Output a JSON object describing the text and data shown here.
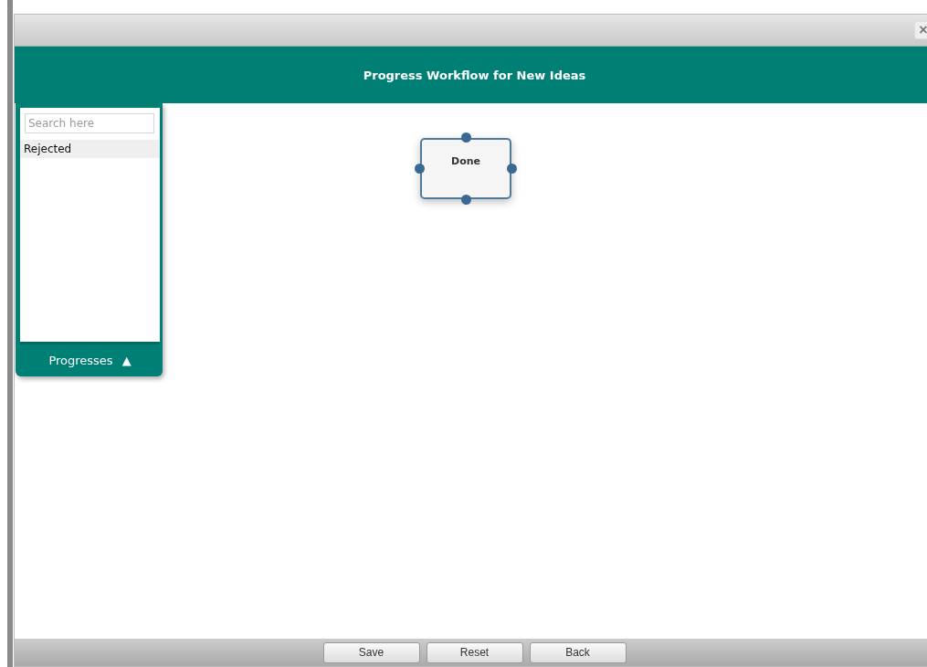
{
  "dialog": {
    "close": "×"
  },
  "header": {
    "title": "Progress Workflow for New Ideas"
  },
  "panel": {
    "search": {
      "placeholder": "Search here"
    },
    "items": [
      {
        "label": "Rejected",
        "selected": true
      }
    ],
    "toggle": {
      "label": "Progresses",
      "arrow": "▲"
    }
  },
  "canvas": {
    "nodes": [
      {
        "label": "Done"
      }
    ]
  },
  "buttons": [
    "Save",
    "Reset",
    "Back"
  ]
}
